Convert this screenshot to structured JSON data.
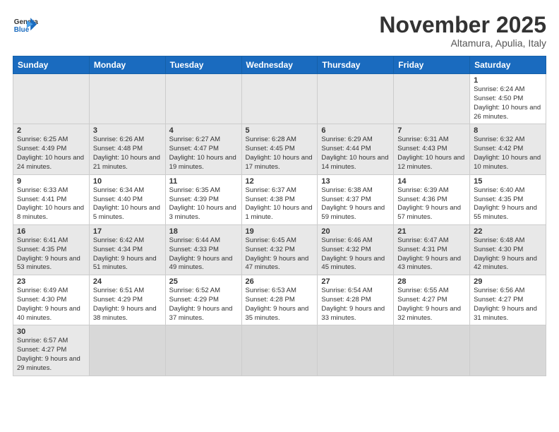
{
  "header": {
    "logo_general": "General",
    "logo_blue": "Blue",
    "month": "November 2025",
    "location": "Altamura, Apulia, Italy"
  },
  "weekdays": [
    "Sunday",
    "Monday",
    "Tuesday",
    "Wednesday",
    "Thursday",
    "Friday",
    "Saturday"
  ],
  "rows": [
    {
      "cells": [
        {
          "day": "",
          "info": ""
        },
        {
          "day": "",
          "info": ""
        },
        {
          "day": "",
          "info": ""
        },
        {
          "day": "",
          "info": ""
        },
        {
          "day": "",
          "info": ""
        },
        {
          "day": "",
          "info": ""
        },
        {
          "day": "1",
          "info": "Sunrise: 6:24 AM\nSunset: 4:50 PM\nDaylight: 10 hours and 26 minutes."
        }
      ]
    },
    {
      "cells": [
        {
          "day": "2",
          "info": "Sunrise: 6:25 AM\nSunset: 4:49 PM\nDaylight: 10 hours and 24 minutes."
        },
        {
          "day": "3",
          "info": "Sunrise: 6:26 AM\nSunset: 4:48 PM\nDaylight: 10 hours and 21 minutes."
        },
        {
          "day": "4",
          "info": "Sunrise: 6:27 AM\nSunset: 4:47 PM\nDaylight: 10 hours and 19 minutes."
        },
        {
          "day": "5",
          "info": "Sunrise: 6:28 AM\nSunset: 4:45 PM\nDaylight: 10 hours and 17 minutes."
        },
        {
          "day": "6",
          "info": "Sunrise: 6:29 AM\nSunset: 4:44 PM\nDaylight: 10 hours and 14 minutes."
        },
        {
          "day": "7",
          "info": "Sunrise: 6:31 AM\nSunset: 4:43 PM\nDaylight: 10 hours and 12 minutes."
        },
        {
          "day": "8",
          "info": "Sunrise: 6:32 AM\nSunset: 4:42 PM\nDaylight: 10 hours and 10 minutes."
        }
      ]
    },
    {
      "cells": [
        {
          "day": "9",
          "info": "Sunrise: 6:33 AM\nSunset: 4:41 PM\nDaylight: 10 hours and 8 minutes."
        },
        {
          "day": "10",
          "info": "Sunrise: 6:34 AM\nSunset: 4:40 PM\nDaylight: 10 hours and 5 minutes."
        },
        {
          "day": "11",
          "info": "Sunrise: 6:35 AM\nSunset: 4:39 PM\nDaylight: 10 hours and 3 minutes."
        },
        {
          "day": "12",
          "info": "Sunrise: 6:37 AM\nSunset: 4:38 PM\nDaylight: 10 hours and 1 minute."
        },
        {
          "day": "13",
          "info": "Sunrise: 6:38 AM\nSunset: 4:37 PM\nDaylight: 9 hours and 59 minutes."
        },
        {
          "day": "14",
          "info": "Sunrise: 6:39 AM\nSunset: 4:36 PM\nDaylight: 9 hours and 57 minutes."
        },
        {
          "day": "15",
          "info": "Sunrise: 6:40 AM\nSunset: 4:35 PM\nDaylight: 9 hours and 55 minutes."
        }
      ]
    },
    {
      "cells": [
        {
          "day": "16",
          "info": "Sunrise: 6:41 AM\nSunset: 4:35 PM\nDaylight: 9 hours and 53 minutes."
        },
        {
          "day": "17",
          "info": "Sunrise: 6:42 AM\nSunset: 4:34 PM\nDaylight: 9 hours and 51 minutes."
        },
        {
          "day": "18",
          "info": "Sunrise: 6:44 AM\nSunset: 4:33 PM\nDaylight: 9 hours and 49 minutes."
        },
        {
          "day": "19",
          "info": "Sunrise: 6:45 AM\nSunset: 4:32 PM\nDaylight: 9 hours and 47 minutes."
        },
        {
          "day": "20",
          "info": "Sunrise: 6:46 AM\nSunset: 4:32 PM\nDaylight: 9 hours and 45 minutes."
        },
        {
          "day": "21",
          "info": "Sunrise: 6:47 AM\nSunset: 4:31 PM\nDaylight: 9 hours and 43 minutes."
        },
        {
          "day": "22",
          "info": "Sunrise: 6:48 AM\nSunset: 4:30 PM\nDaylight: 9 hours and 42 minutes."
        }
      ]
    },
    {
      "cells": [
        {
          "day": "23",
          "info": "Sunrise: 6:49 AM\nSunset: 4:30 PM\nDaylight: 9 hours and 40 minutes."
        },
        {
          "day": "24",
          "info": "Sunrise: 6:51 AM\nSunset: 4:29 PM\nDaylight: 9 hours and 38 minutes."
        },
        {
          "day": "25",
          "info": "Sunrise: 6:52 AM\nSunset: 4:29 PM\nDaylight: 9 hours and 37 minutes."
        },
        {
          "day": "26",
          "info": "Sunrise: 6:53 AM\nSunset: 4:28 PM\nDaylight: 9 hours and 35 minutes."
        },
        {
          "day": "27",
          "info": "Sunrise: 6:54 AM\nSunset: 4:28 PM\nDaylight: 9 hours and 33 minutes."
        },
        {
          "day": "28",
          "info": "Sunrise: 6:55 AM\nSunset: 4:27 PM\nDaylight: 9 hours and 32 minutes."
        },
        {
          "day": "29",
          "info": "Sunrise: 6:56 AM\nSunset: 4:27 PM\nDaylight: 9 hours and 31 minutes."
        }
      ]
    },
    {
      "cells": [
        {
          "day": "30",
          "info": "Sunrise: 6:57 AM\nSunset: 4:27 PM\nDaylight: 9 hours and 29 minutes."
        },
        {
          "day": "",
          "info": ""
        },
        {
          "day": "",
          "info": ""
        },
        {
          "day": "",
          "info": ""
        },
        {
          "day": "",
          "info": ""
        },
        {
          "day": "",
          "info": ""
        },
        {
          "day": "",
          "info": ""
        }
      ]
    }
  ]
}
